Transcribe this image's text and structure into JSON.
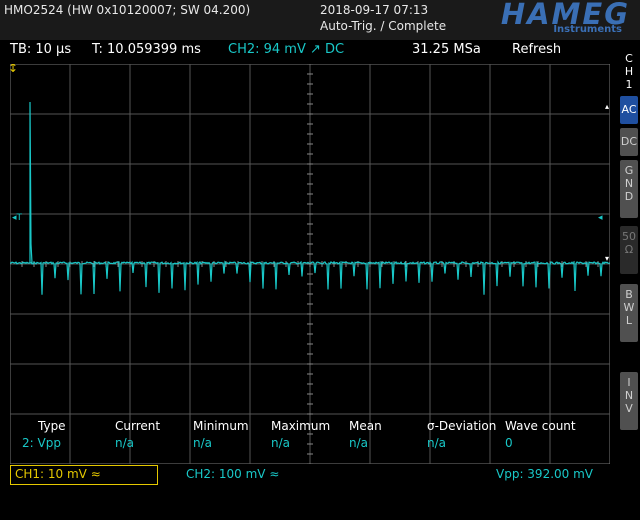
{
  "header": {
    "device": "HMO2524 (HW 0x10120007; SW 04.200)",
    "datetime": "2018-09-17 07:13",
    "mode": "Auto-Trig. / Complete",
    "brand": "HAMEG",
    "brand_sub": "Instruments"
  },
  "status": {
    "timebase": "TB: 10 µs",
    "trigger_time": "T: 10.059399 ms",
    "trigger": "CH2: 94 mV ↗ DC",
    "sample_rate": "31.25 MSa",
    "acq_mode": "Refresh"
  },
  "sidebar": {
    "channel": [
      "C",
      "H",
      "1"
    ],
    "buttons": [
      {
        "label": "AC",
        "state": "active"
      },
      {
        "label": "DC",
        "state": "normal"
      },
      {
        "label": "G\nN\nD",
        "state": "normal"
      },
      {
        "label": "50\nΩ",
        "state": "disabled"
      },
      {
        "label": "B\nW\nL",
        "state": "normal"
      },
      {
        "label": "I\nN\nV",
        "state": "normal"
      }
    ]
  },
  "measurements": {
    "headers": [
      "Type",
      "Current",
      "Minimum",
      "Maximum",
      "Mean",
      "σ-Deviation",
      "Wave count"
    ],
    "row": [
      "2: Vpp",
      "n/a",
      "n/a",
      "n/a",
      "n/a",
      "n/a",
      "0"
    ]
  },
  "bottom": {
    "ch1": "CH1: 10 mV ≈",
    "ch2": "CH2: 100 mV ≈",
    "vpp": "Vpp: 392.00 mV"
  },
  "colors": {
    "ch1": "#e5c800",
    "ch2": "#19c8c8",
    "accent": "#1f4fa0",
    "brand": "#3a6fb5"
  },
  "markers": {
    "trigger_level": "T",
    "channel_ref": "2"
  }
}
